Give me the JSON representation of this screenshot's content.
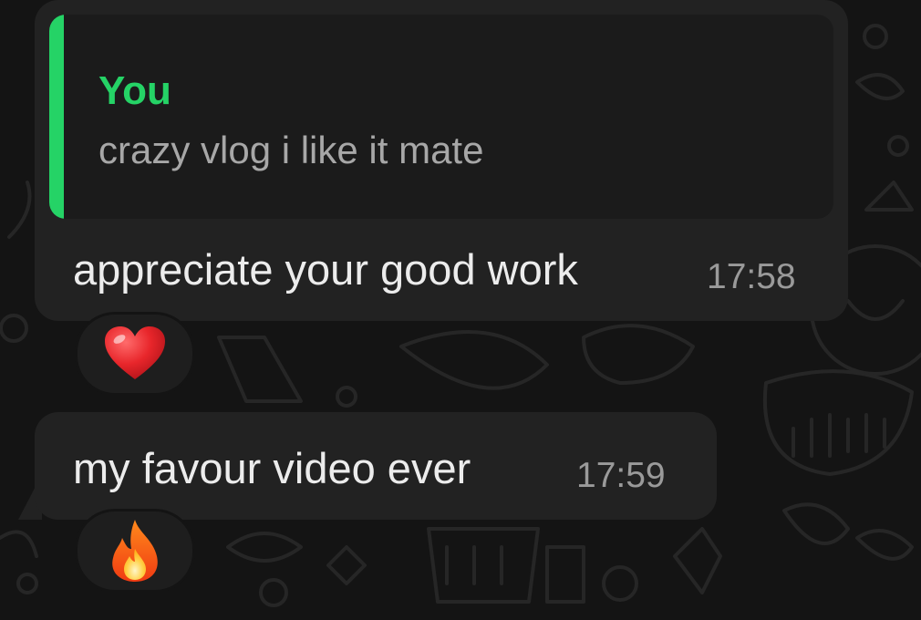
{
  "quoted_reply": {
    "author": "You",
    "text": "crazy vlog i like it mate"
  },
  "messages": [
    {
      "text": "appreciate your good work",
      "time": "17:58",
      "reaction_icon": "red-heart-icon"
    },
    {
      "text": "my favour video ever",
      "time": "17:59",
      "reaction_icon": "fire-icon"
    }
  ],
  "colors": {
    "accent_green": "#25d366",
    "bubble": "#222222",
    "background": "#141414",
    "timestamp": "#9a9a9a",
    "message_text": "#ececec",
    "quote_text": "#a7a7a7",
    "heart": "#e8262b",
    "fire": "#ff6a13"
  }
}
